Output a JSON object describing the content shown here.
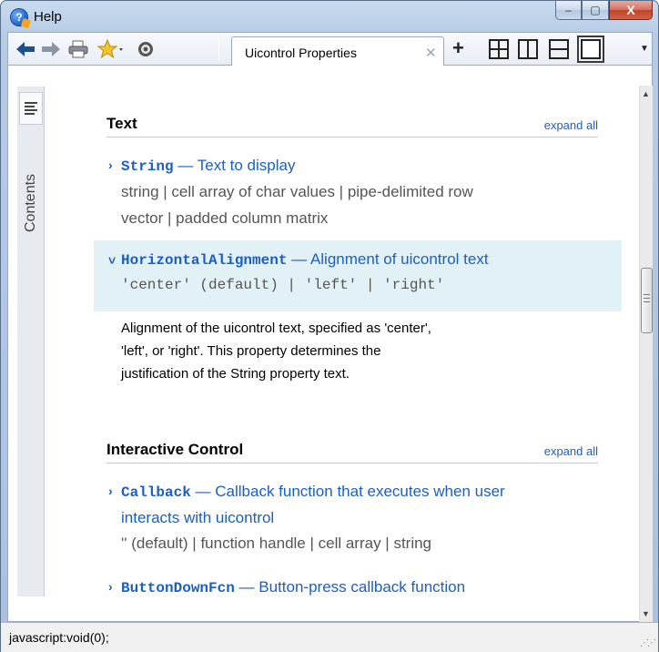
{
  "window": {
    "title": "Help",
    "controls": {
      "minimize": "–",
      "maximize": "▢",
      "close": "X"
    }
  },
  "toolbar": {
    "icons": [
      "back-icon",
      "forward-icon",
      "print-icon",
      "favorites-icon",
      "gear-icon"
    ],
    "tab_label": "Uicontrol Properties",
    "tab_close": "✕",
    "new_tab": "+"
  },
  "sidebar": {
    "contents_label": "Contents"
  },
  "sections": [
    {
      "title": "Text",
      "expand_label": "expand all",
      "props": [
        {
          "name": "String",
          "summary": " — Text to display",
          "values_line1": "string | cell array of char values | pipe-delimited row",
          "values_line2": "vector | padded column matrix"
        },
        {
          "name": "HorizontalAlignment",
          "summary": " — Alignment of uicontrol text",
          "values_line1": "'center' (default) | 'left' | 'right'",
          "description_line1": "Alignment of the uicontrol text, specified as 'center',",
          "description_line2": "'left', or 'right'. This property determines the",
          "description_line3": "justification of the String property text."
        }
      ]
    },
    {
      "title": "Interactive Control",
      "expand_label": "expand all",
      "props": [
        {
          "name": "Callback",
          "summary": " — Callback function that executes when user",
          "summary_line2": "interacts with uicontrol",
          "values_line1": "'' (default) | function handle | cell array | string"
        },
        {
          "name": "ButtonDownFcn",
          "summary": " — Button-press callback function"
        }
      ]
    }
  ],
  "status": {
    "text": "javascript:void(0);"
  }
}
